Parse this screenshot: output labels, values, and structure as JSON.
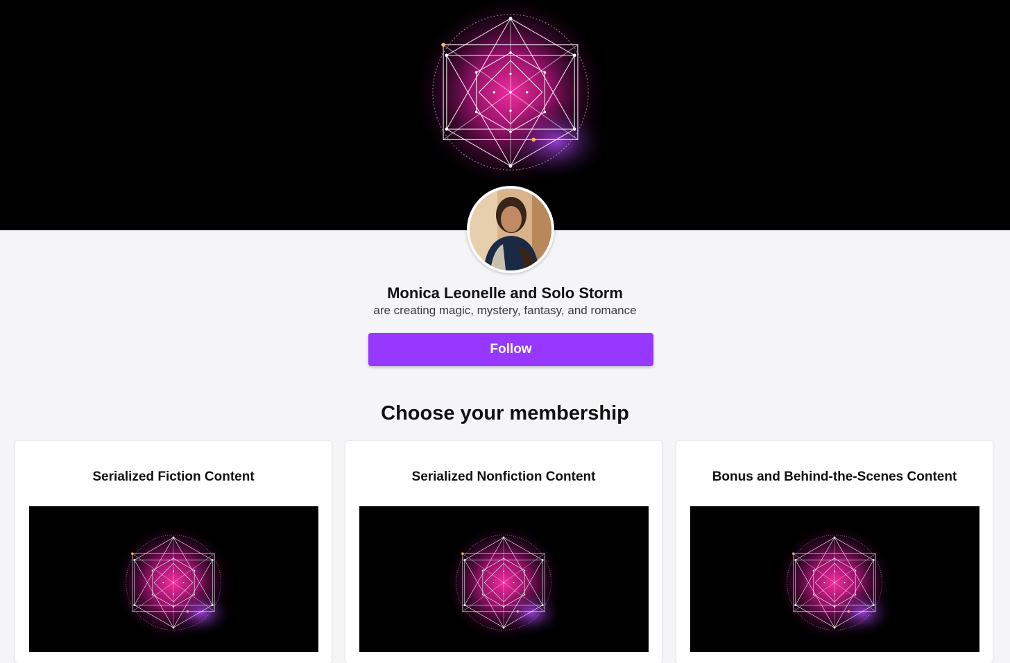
{
  "creator": {
    "name": "Monica Leonelle and Solo Storm",
    "tagline": "are creating magic, mystery, fantasy, and romance"
  },
  "actions": {
    "follow_label": "Follow"
  },
  "membership": {
    "section_title": "Choose your membership",
    "tiers": [
      {
        "title": "Serialized Fiction Content"
      },
      {
        "title": "Serialized Nonfiction Content"
      },
      {
        "title": "Bonus and Behind-the-Scenes Content"
      }
    ]
  },
  "colors": {
    "accent": "#9638ff",
    "banner_bg": "#000000",
    "page_bg": "#f5f5f7"
  },
  "icons": {
    "banner_art": "sacred-geometry-nebula"
  }
}
